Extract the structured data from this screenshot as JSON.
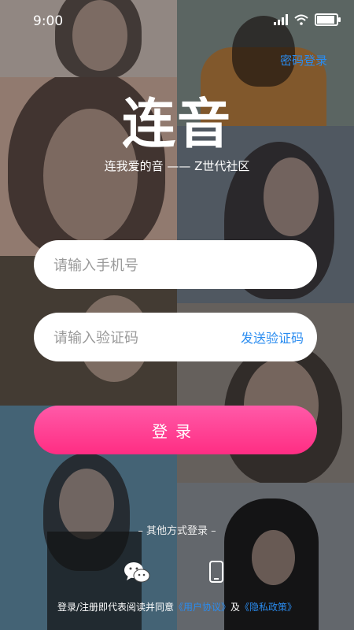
{
  "status_bar": {
    "time": "9:00",
    "battery_level": 0.85
  },
  "header": {
    "password_login_label": "密码登录"
  },
  "brand": {
    "logo_text": "连音",
    "slogan": "连我爱的音 —— Z世代社区"
  },
  "form": {
    "phone_placeholder": "请输入手机号",
    "code_placeholder": "请输入验证码",
    "send_code_label": "发送验证码",
    "login_label": "登录"
  },
  "alternative": {
    "title": "– 其他方式登录 –",
    "icons": [
      "wechat-icon",
      "phone-icon"
    ]
  },
  "agreement": {
    "prefix": "登录/注册即代表阅读并同意",
    "user_agreement": "《用户协议》",
    "and": "及",
    "privacy_policy": "《隐私政策》"
  },
  "colors": {
    "accent": "#2a8cf0",
    "login_button": "#ff3d8f"
  }
}
